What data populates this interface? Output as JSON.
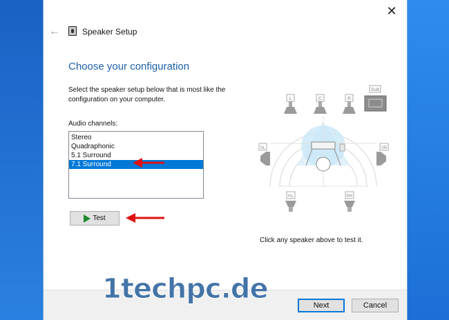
{
  "window": {
    "title": "Speaker Setup",
    "close_glyph": "✕",
    "back_glyph": "←"
  },
  "main": {
    "heading": "Choose your configuration",
    "instruction": "Select the speaker setup below that is most like the configuration on your computer.",
    "channels_label": "Audio channels:",
    "channels": [
      {
        "label": "Stereo",
        "selected": false
      },
      {
        "label": "Quadraphonic",
        "selected": false
      },
      {
        "label": "5.1 Surround",
        "selected": false
      },
      {
        "label": "7.1 Surround",
        "selected": true
      }
    ],
    "test_label": "Test",
    "hint": "Click any speaker above to test it."
  },
  "speakers": {
    "L": "L",
    "C": "C",
    "R": "R",
    "Sub": "Sub",
    "SL": "SL",
    "SR": "SR",
    "RL": "RL",
    "RR": "RR"
  },
  "footer": {
    "next_label": "Next",
    "cancel_label": "Cancel"
  },
  "watermark": "1techpc.de",
  "colors": {
    "accent": "#0078d7",
    "heading": "#1b5fa8",
    "arrow": "#e01010",
    "play": "#1e8a2e"
  }
}
